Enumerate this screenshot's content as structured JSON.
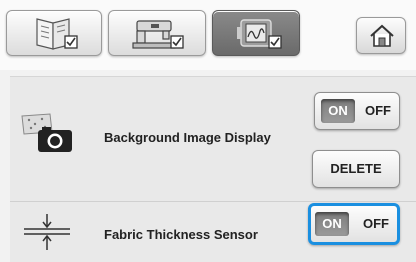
{
  "tabs": [
    {
      "icon": "settings-book-icon"
    },
    {
      "icon": "sewing-machine-icon"
    },
    {
      "icon": "embroidery-frame-icon",
      "active": true
    }
  ],
  "home": {
    "icon": "home-icon"
  },
  "settings": {
    "background_image": {
      "label": "Background Image Display",
      "toggle_on": "ON",
      "toggle_off": "OFF",
      "delete_label": "DELETE",
      "icon": "camera-icon"
    },
    "fabric_thickness": {
      "label": "Fabric Thickness Sensor",
      "toggle_on": "ON",
      "toggle_off": "OFF",
      "icon": "thickness-sensor-icon"
    }
  },
  "colors": {
    "selection_accent": "#1a8fe0",
    "on_state": "#808080"
  }
}
